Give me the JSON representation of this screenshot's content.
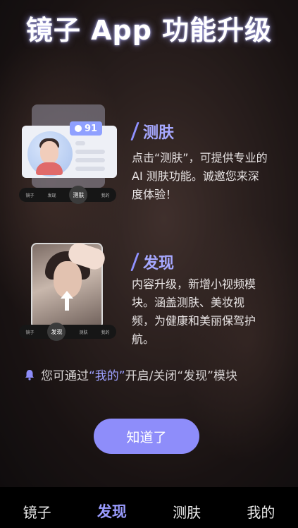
{
  "title": "镜子 App 功能升级",
  "features": [
    {
      "heading": "测肤",
      "lines": [
        "点击“测肤”，可提供专业的",
        "AI 测肤功能。诚邀您来深",
        "度体验！"
      ]
    },
    {
      "heading": "发现",
      "lines": [
        "内容升级，新增小视频模",
        "块。涵盖测肤、美妆视",
        "频，为健康和美丽保驾护",
        "航。"
      ]
    }
  ],
  "illustration1": {
    "score": "91",
    "tabs": [
      "镜子",
      "发现",
      "测肤",
      "我的"
    ]
  },
  "illustration2": {
    "tabs": [
      "镜子",
      "发现",
      "测肤",
      "我的"
    ]
  },
  "notice": {
    "prefix": "您可通过",
    "highlight": "“我的”",
    "suffix": "开启/关闭“发现”模块",
    "icon": "bell-icon"
  },
  "ok_button": "知道了",
  "bottom_nav": [
    "镜子",
    "发现",
    "测肤",
    "我的"
  ],
  "colors": {
    "accent": "#8e8dfa",
    "highlight": "#9ea1ff"
  }
}
